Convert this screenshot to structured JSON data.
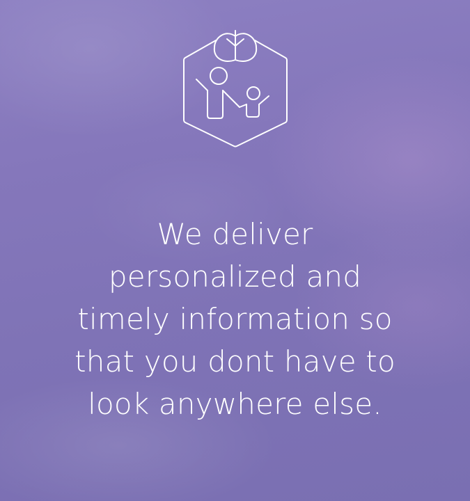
{
  "logo": {
    "icon": "family-tree-hexagon-icon",
    "stroke_color": "#ffffff"
  },
  "tagline": {
    "lines": [
      "We deliver",
      "personalized and",
      "timely information so",
      "that you dont have to",
      "look anywhere else."
    ]
  },
  "colors": {
    "background": "#8577bb",
    "text": "#ffffff"
  }
}
